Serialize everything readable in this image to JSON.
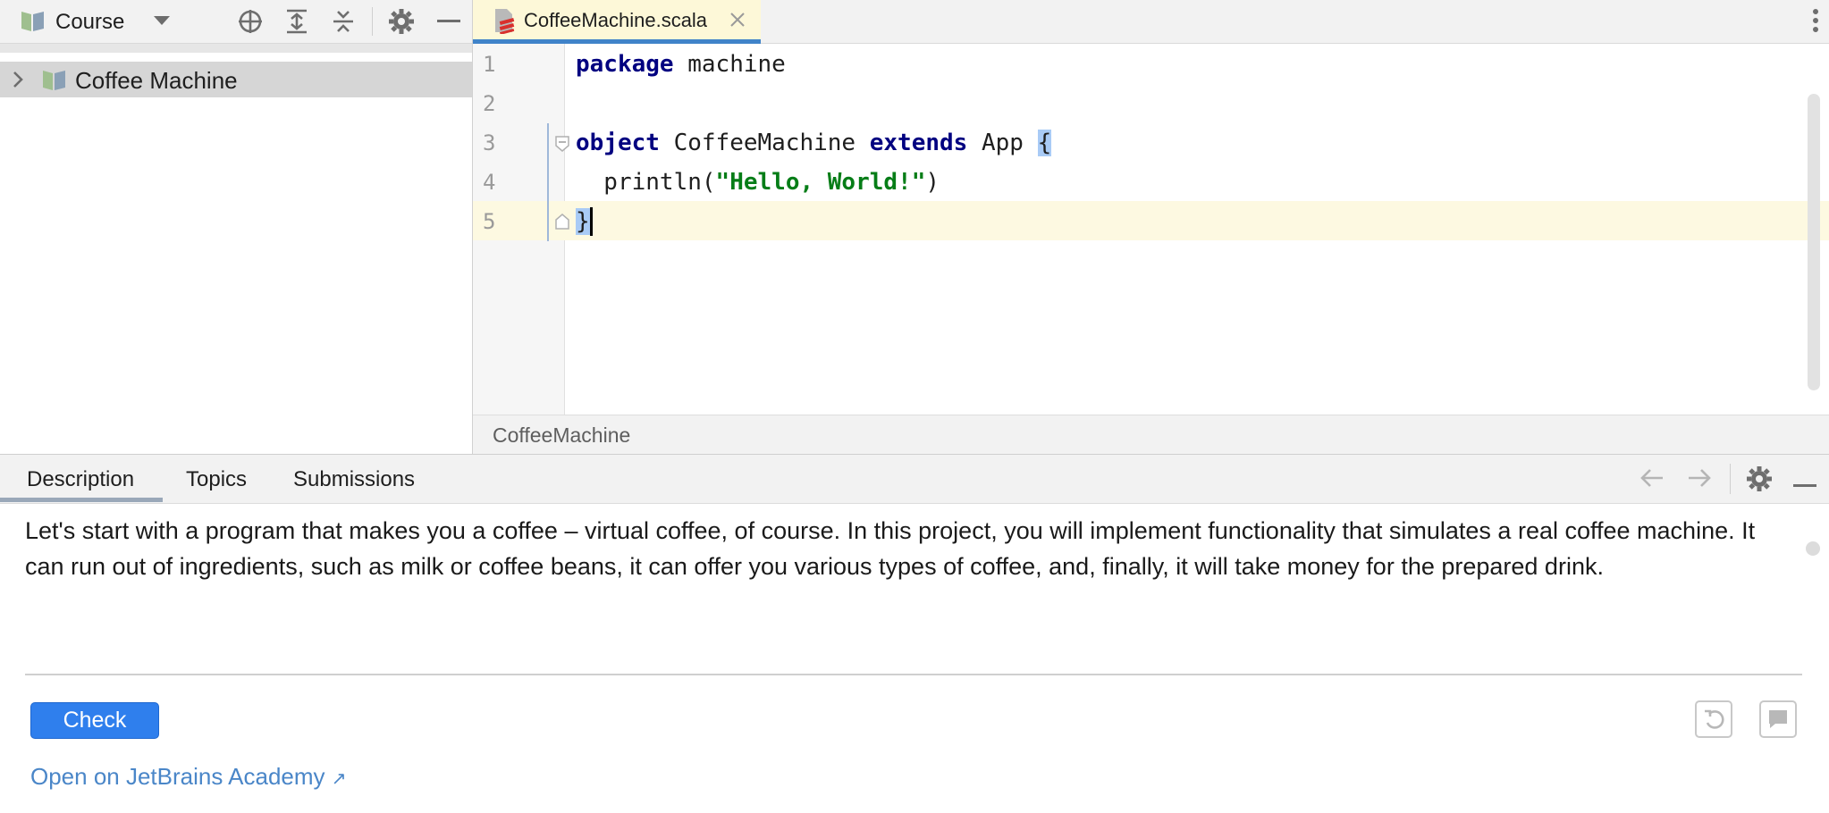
{
  "project_panel": {
    "view_name": "Course",
    "tree": [
      {
        "label": "Coffee Machine",
        "expanded": false
      }
    ],
    "icons": [
      "book-icon",
      "chevron-down-icon",
      "locate-icon",
      "expand-all-icon",
      "collapse-all-icon",
      "gear-icon",
      "minimize-icon"
    ]
  },
  "editor": {
    "tab_title": "CoffeeMachine.scala",
    "line_numbers": [
      "1",
      "2",
      "3",
      "4",
      "5"
    ],
    "code": {
      "line1_kw": "package",
      "line1_rest": " machine",
      "line3_kw1": "object",
      "line3_name": " CoffeeMachine ",
      "line3_kw2": "extends",
      "line3_rest": " App ",
      "line3_brace": "{",
      "line4_call": "  println(",
      "line4_str": "\"Hello, World!\"",
      "line4_end": ")",
      "line5_brace": "}"
    },
    "breadcrumb": "CoffeeMachine",
    "accent_color": "#4083c9"
  },
  "task_panel": {
    "tabs": [
      "Description",
      "Topics",
      "Submissions"
    ],
    "active_tab": "Description",
    "description": "Let's start with a program that makes you a coffee – virtual coffee, of course. In this project, you will implement functionality that simulates a real coffee machine. It can run out of ingredients, such as milk or coffee beans, it can offer you various types of coffee, and, finally, it will take money for the prepared drink.",
    "check_label": "Check",
    "academy_link": "Open on JetBrains Academy",
    "academy_link_arrow": "↗",
    "button_color": "#2f7fed"
  }
}
